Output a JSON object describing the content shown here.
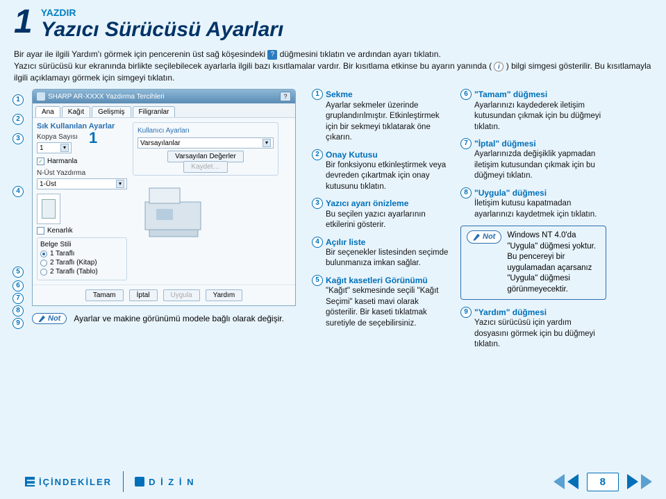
{
  "header": {
    "chapter": "1",
    "subtitle": "YAZDIR",
    "title": "Yazıcı Sürücüsü Ayarları"
  },
  "intro": {
    "p1a": "Bir ayar ile ilgili Yardım'ı görmek için pencerenin üst sağ köşesindeki ",
    "p1b": " düğmesini tıklatın ve ardından ayarı tıklatın.",
    "p2a": "Yazıcı sürücüsü kur ekranında birlikte seçilebilecek ayarlarla ilgili bazı kısıtlamalar vardır. Bir kısıtlama etkinse bu ayarın yanında ( ",
    "p2b": " ) bilgi simgesi gösterilir. Bu kısıtlamayla ilgili açıklamayı görmek için simgeyi tıklatın.",
    "help_glyph": "?",
    "info_glyph": "i"
  },
  "dialog": {
    "title": "SHARP AR-XXXX Yazdırma Tercihleri",
    "help_btn": "?",
    "tabs": [
      "Ana",
      "Kağıt",
      "Gelişmiş",
      "Filigranlar"
    ],
    "left_section": "Sık Kullanılan Ayarlar",
    "kopya_label": "Kopya Sayısı",
    "kopya_value": "1",
    "harmanla": "Harmanla",
    "nust_label": "N-Üst Yazdırma",
    "nust_value": "1-Üst",
    "kenarlik": "Kenarlık",
    "belge_label": "Belge Stili",
    "belge_opts": [
      "1 Taraflı",
      "2 Taraflı (Kitap)",
      "2 Taraflı (Tablo)"
    ],
    "kull_label": "Kullanıcı Ayarları",
    "kull_value": "Varsayılanlar",
    "vars_btn": "Varsayılan Değerler",
    "kaydet_btn": "Kaydet…",
    "btns": {
      "tamam": "Tamam",
      "iptal": "İptal",
      "uygula": "Uygula",
      "yardim": "Yardım"
    },
    "big1": "1"
  },
  "callouts": {
    "n1": "1",
    "n2": "2",
    "n3": "3",
    "n4": "4",
    "n5": "5",
    "n6": "6",
    "n7": "7",
    "n8": "8",
    "n9": "9"
  },
  "note_pill": "Not",
  "note_left": "Ayarlar ve makine görünümü modele bağlı olarak değişir.",
  "mid": {
    "i1t": "Sekme",
    "i1b": "Ayarlar sekmeler üzerinde gruplandırılmıştır. Etkinleştirmek için bir sekmeyi tıklatarak öne çıkarın.",
    "i2t": "Onay Kutusu",
    "i2b": "Bir fonksiyonu etkinleştirmek veya devreden çıkartmak için onay kutusunu tıklatın.",
    "i3t": "Yazıcı ayarı önizleme",
    "i3b": "Bu seçilen yazıcı ayarlarının etkilerini gösterir.",
    "i4t": "Açılır liste",
    "i4b": "Bir seçenekler listesinden seçimde bulunmanıza imkan sağlar.",
    "i5t": "Kağıt kasetleri Görünümü",
    "i5b": "\"Kağıt\" sekmesinde seçili \"Kağıt Seçimi\" kaseti mavi olarak gösterilir. Bir kaseti tıklatmak suretiyle de seçebilirsiniz."
  },
  "right": {
    "i6t": "\"Tamam\" düğmesi",
    "i6b": "Ayarlarınızı kaydederek iletişim kutusundan çıkmak için bu düğmeyi tıklatın.",
    "i7t": "\"İptal\" düğmesi",
    "i7b": "Ayarlarınızda değişiklik yapmadan iletişim kutusundan çıkmak için bu düğmeyi tıklatın.",
    "i8t": "\"Uygula\" düğmesi",
    "i8b": "İletişim kutusu kapatmadan ayarlarınızı kaydetmek için tıklatın.",
    "note": "Windows NT 4.0'da \"Uygula\" düğmesi yoktur.\nBu pencereyi bir uygulamadan açarsanız \"Uygula\" düğmesi görünmeyecektir.",
    "i9t": "\"Yardım\" düğmesi",
    "i9b": "Yazıcı sürücüsü için yardım dosyasını görmek için bu düğmeyi tıklatın."
  },
  "footer": {
    "contents": "İÇİNDEKİLER",
    "index": "D İ Z İ N",
    "page": "8"
  }
}
